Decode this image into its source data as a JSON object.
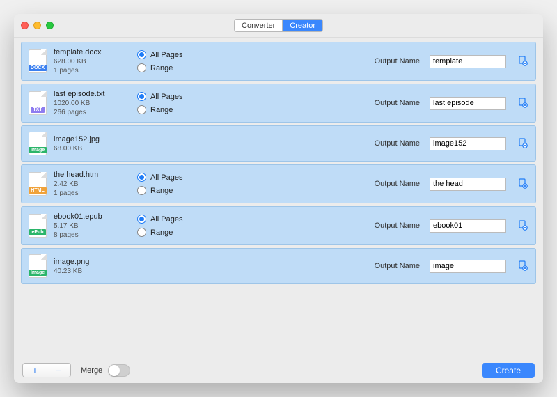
{
  "tabs": {
    "converter": "Converter",
    "creator": "Creator",
    "active": "creator"
  },
  "radio_labels": {
    "all": "All Pages",
    "range": "Range"
  },
  "output_label": "Output Name",
  "footer": {
    "merge_label": "Merge",
    "create_label": "Create",
    "plus": "+",
    "minus": "−"
  },
  "icon_types": {
    "DOCX": {
      "label": "DOCX",
      "bg": "#3a7ff0"
    },
    "TXT": {
      "label": "TXT",
      "bg": "#8e7cf0"
    },
    "Image": {
      "label": "Image",
      "bg": "#2bb56a"
    },
    "HTML": {
      "label": "HTML",
      "bg": "#f0a23a"
    },
    "ePub": {
      "label": "ePub",
      "bg": "#2bb56a"
    }
  },
  "files": [
    {
      "name": "template.docx",
      "size": "628.00 KB",
      "pages": "1 pages",
      "type": "DOCX",
      "output": "template",
      "selected": "all",
      "show_radios": true
    },
    {
      "name": "last episode.txt",
      "size": "1020.00 KB",
      "pages": "266 pages",
      "type": "TXT",
      "output": "last episode",
      "selected": "all",
      "show_radios": true
    },
    {
      "name": "image152.jpg",
      "size": "68.00 KB",
      "pages": "",
      "type": "Image",
      "output": "image152",
      "selected": "",
      "show_radios": false
    },
    {
      "name": "the head.htm",
      "size": "2.42 KB",
      "pages": "1 pages",
      "type": "HTML",
      "output": "the head",
      "selected": "all",
      "show_radios": true
    },
    {
      "name": "ebook01.epub",
      "size": "5.17 KB",
      "pages": "8 pages",
      "type": "ePub",
      "output": "ebook01",
      "selected": "all",
      "show_radios": true
    },
    {
      "name": "image.png",
      "size": "40.23 KB",
      "pages": "",
      "type": "Image",
      "output": "image",
      "selected": "",
      "show_radios": false
    }
  ]
}
